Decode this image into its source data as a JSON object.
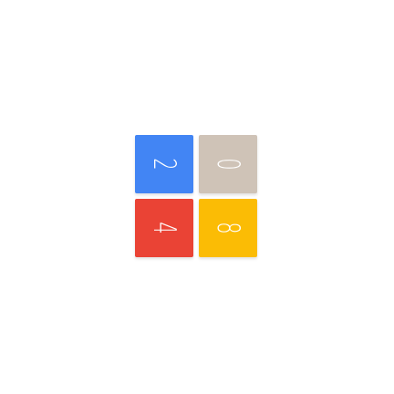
{
  "board": {
    "tiles": [
      {
        "value": "2",
        "color": "#4285F4",
        "text_color": "#ffffff"
      },
      {
        "value": "0",
        "color": "#CFC3B7",
        "text_color": "#ffffff"
      },
      {
        "value": "4",
        "color": "#EA4335",
        "text_color": "#ffffff"
      },
      {
        "value": "8",
        "color": "#FBBC05",
        "text_color": "#ffffff"
      }
    ]
  }
}
